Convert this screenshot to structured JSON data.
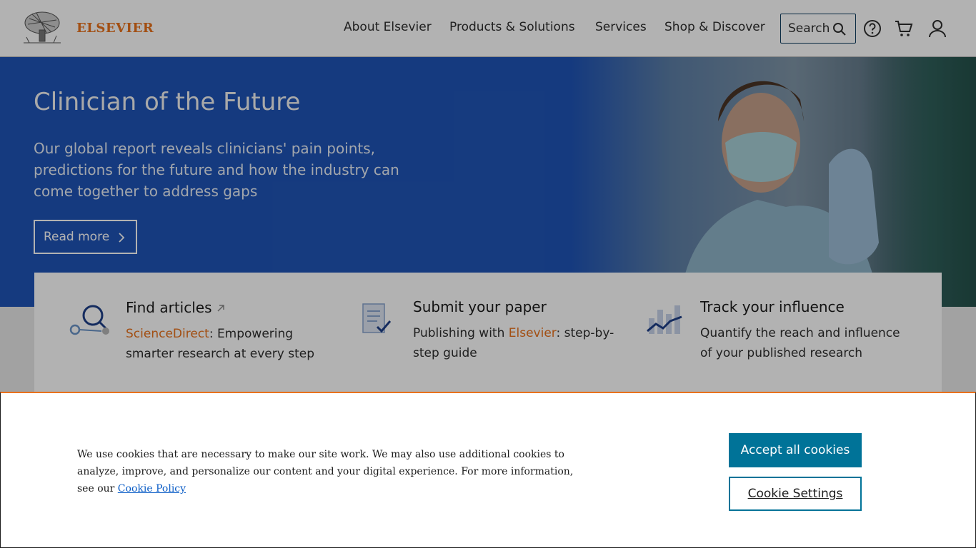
{
  "header": {
    "brand": "ELSEVIER",
    "nav": [
      "About Elsevier",
      "Products & Solutions",
      "Services",
      "Shop & Discover"
    ],
    "search_label": "Search",
    "icons": [
      "help-icon",
      "cart-icon",
      "user-icon"
    ]
  },
  "hero": {
    "title": "Clinician of the Future",
    "subtitle": "Our global report reveals clinicians' pain points, predictions for the future and how the industry can come together to address gaps",
    "cta": "Read more"
  },
  "cards": [
    {
      "title": "Find articles",
      "prefix_link": "ScienceDirect",
      "text_after": ": Empowering smarter research at every step",
      "icon": "magnifier-icon"
    },
    {
      "title": "Submit your paper",
      "text_before": "Publishing with ",
      "link": "Elsevier",
      "text_after": ": step-by-step guide",
      "icon": "document-check-icon"
    },
    {
      "title": "Track your influence",
      "text": "Quantify the reach and influence of your published research",
      "icon": "chart-icon"
    }
  ],
  "cookie": {
    "text": "We use cookies that are necessary to make our site work. We may also use additional cookies to analyze, improve, and personalize our content and your digital experience. For more information, see our ",
    "link": "Cookie Policy",
    "accept": "Accept all cookies",
    "settings": "Cookie Settings"
  },
  "colors": {
    "brand_orange": "#e9711c",
    "hero_blue": "#1f54b6",
    "cookie_teal": "#007398"
  }
}
